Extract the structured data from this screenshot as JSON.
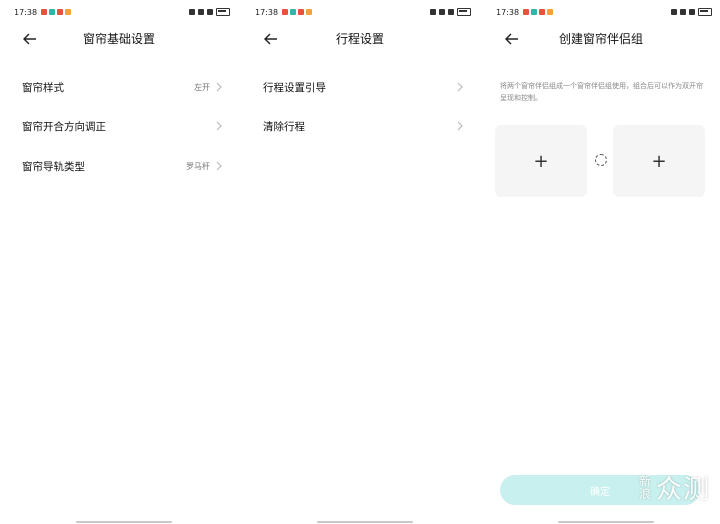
{
  "panels": [
    {
      "status_time": "17:38",
      "title": "窗帘基础设置",
      "rows": [
        {
          "label": "窗帘样式",
          "value": "左开"
        },
        {
          "label": "窗帘开合方向调正",
          "value": ""
        },
        {
          "label": "窗帘导轨类型",
          "value": "罗马杆"
        }
      ]
    },
    {
      "status_time": "17:38",
      "title": "行程设置",
      "rows": [
        {
          "label": "行程设置引导",
          "value": ""
        },
        {
          "label": "清除行程",
          "value": ""
        }
      ]
    },
    {
      "status_time": "17:38",
      "title": "创建窗帘伴侣组",
      "description": "将两个窗帘伴侣组成一个窗帘伴侣组使用，组合后可以作为双开帘呈现和控制。",
      "tile_left": "+",
      "tile_right": "+",
      "confirm_label": "确定"
    }
  ],
  "watermark": {
    "small": "新浪",
    "large": "众测"
  },
  "colors": {
    "accent": "#c8f0ee",
    "tile_bg": "#f5f5f5",
    "muted_text": "#888888"
  },
  "icons": [
    "back-arrow-icon",
    "chevron-right-icon",
    "link-circle-icon",
    "plus-icon"
  ]
}
